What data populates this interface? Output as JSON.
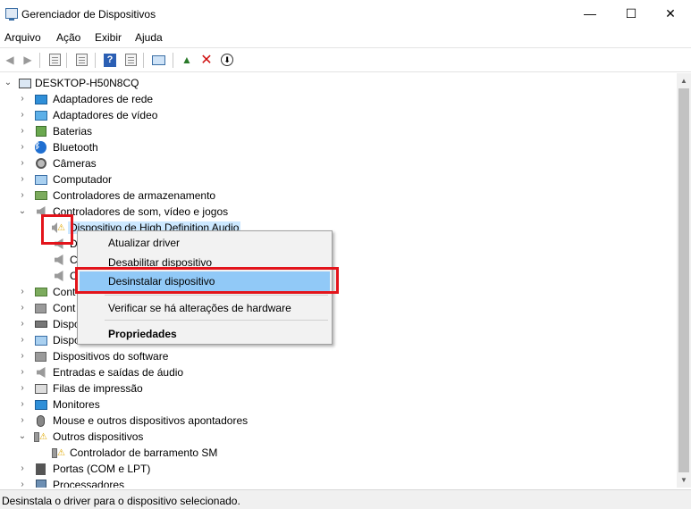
{
  "window": {
    "title": "Gerenciador de Dispositivos",
    "minimize_glyph": "—",
    "maximize_glyph": "☐",
    "close_glyph": "✕"
  },
  "menu": [
    "Arquivo",
    "Ação",
    "Exibir",
    "Ajuda"
  ],
  "toolbar": {
    "icons": [
      "back-arrow-icon",
      "forward-arrow-icon",
      "show-hide-tree-icon",
      "properties-icon",
      "help-icon",
      "update-driver-icon",
      "scan-hardware-icon",
      "add-driver-icon",
      "uninstall-x-icon",
      "download-icon"
    ],
    "help_glyph": "?",
    "uninstall_glyph": "✕",
    "download_glyph": "⬇"
  },
  "tree": {
    "root": "DESKTOP-H50N8CQ",
    "categories": [
      {
        "label": "Adaptadores de rede",
        "icon": "network-adapter-icon"
      },
      {
        "label": "Adaptadores de vídeo",
        "icon": "display-adapter-icon"
      },
      {
        "label": "Baterias",
        "icon": "battery-icon"
      },
      {
        "label": "Bluetooth",
        "icon": "bluetooth-icon"
      },
      {
        "label": "Câmeras",
        "icon": "camera-icon"
      },
      {
        "label": "Computador",
        "icon": "computer-icon"
      },
      {
        "label": "Controladores de armazenamento",
        "icon": "storage-controller-icon"
      },
      {
        "label": "Controladores de som, vídeo e jogos",
        "icon": "speaker-icon",
        "expanded": true
      }
    ],
    "sound_children": [
      {
        "label": "Dispositivo de High Definition Audio",
        "warning": true,
        "selected": true
      },
      {
        "label": "D",
        "partial": true
      },
      {
        "label": "C",
        "partial": true
      },
      {
        "label": "C",
        "partial": true
      }
    ],
    "more_categories": [
      {
        "label": "Cont",
        "icon": "controller-icon"
      },
      {
        "label": "Cont",
        "icon": "controller-icon"
      },
      {
        "label": "Dispo",
        "icon": "device-icon"
      },
      {
        "label": "Dispo",
        "icon": "device-icon"
      },
      {
        "label": "Dispositivos do software",
        "icon": "software-device-icon"
      },
      {
        "label": "Entradas e saídas de áudio",
        "icon": "audio-io-icon"
      },
      {
        "label": "Filas de impressão",
        "icon": "printer-icon"
      },
      {
        "label": "Monitores",
        "icon": "monitor-icon"
      },
      {
        "label": "Mouse e outros dispositivos apontadores",
        "icon": "mouse-icon"
      },
      {
        "label": "Outros dispositivos",
        "icon": "other-devices-icon",
        "expanded": true
      }
    ],
    "other_children": [
      {
        "label": "Controlador de barramento SM",
        "warning": true
      }
    ],
    "tail_categories": [
      {
        "label": "Portas (COM e LPT)",
        "icon": "port-icon"
      },
      {
        "label": "Processadores",
        "icon": "processor-icon"
      }
    ]
  },
  "context_menu": {
    "items": [
      {
        "label": "Atualizar driver"
      },
      {
        "label": "Desabilitar dispositivo"
      },
      {
        "label": "Desinstalar dispositivo",
        "highlighted": true
      },
      {
        "label": "Verificar se há alterações de hardware"
      },
      {
        "label": "Propriedades",
        "bold": true
      }
    ]
  },
  "status_bar": {
    "text": "Desinstala o driver para o dispositivo selecionado."
  },
  "colors": {
    "highlight_red": "#e3141b",
    "menu_highlight": "#91c9f7",
    "selection": "#cce8ff"
  }
}
